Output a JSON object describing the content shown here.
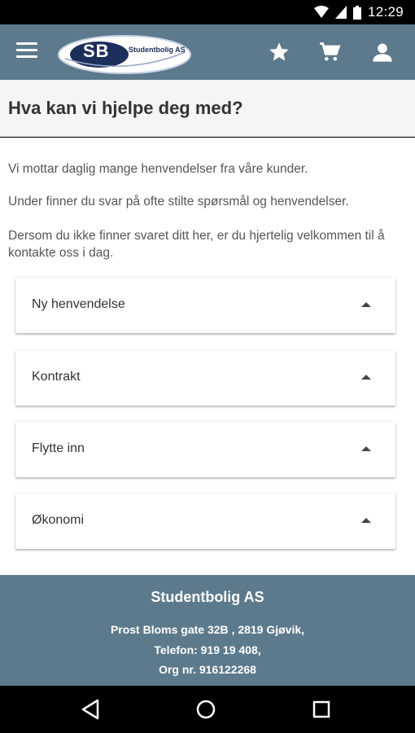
{
  "status_bar": {
    "time": "12:29"
  },
  "app_bar": {
    "logo_initials": "SB",
    "logo_name": "Studentbolig AS",
    "icons": [
      "menu-icon",
      "star-icon",
      "cart-icon",
      "person-icon"
    ]
  },
  "page": {
    "title": "Hva kan vi hjelpe deg med?",
    "paragraphs": [
      "Vi mottar daglig mange henvendelser fra våre kunder.",
      "Under finner du svar på ofte stilte spørsmål og henvendelser.",
      "Dersom du ikke finner svaret ditt her, er du hjertelig velkommen til å kontakte oss i dag."
    ]
  },
  "faq": {
    "items": [
      {
        "label": "Ny henvendelse"
      },
      {
        "label": "Kontrakt"
      },
      {
        "label": "Flytte inn"
      },
      {
        "label": "Økonomi"
      }
    ]
  },
  "footer": {
    "company": "Studentbolig AS",
    "address": "Prost Bloms gate 32B , 2819 Gjøvik,",
    "phone": "Telefon: 919 19 408,",
    "org": "Org nr. 916122268"
  },
  "colors": {
    "app_bar": "#5c7a8b",
    "footer": "#5c7a8b",
    "logo_navy": "#1c2e5c"
  }
}
